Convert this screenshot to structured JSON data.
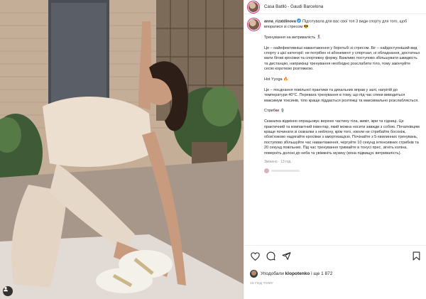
{
  "header": {
    "location": "Casa Batlló - Gaudi Barcelona"
  },
  "caption": {
    "username": "anna_rizatdinova",
    "intro": "Підготувала для вас свої топ 3 види спорту для того, щоб впоратися зі стресом 😎",
    "section1_title": "Тренування на витривалість 🏃‍♀️",
    "section1_body": "Це – найефективніші навантаження у боротьбі зі стресом. Біг – найдоступніший вид спорту з цієї категорії: не потрібен ні абонемент у спортзал, ні обладнання, достатньо мати бігові кросівки та спортивну форму. Важливо поступово збільшувати швидкість та дистанцію, наприкінці тренування необхідно розслабити тіло, тому закінчуйте сесію короткою розтяжкою.",
    "section2_title": "Hot Yyoga 🔥",
    "section2_body": "Це – поєднання повільної практики та дихальних вправ у залі, нагрітій до температури 40°С. Перевага тренування в тому, що під час спеки виводиться максимум токсинів, тіло краще піддається розтяжці та максимально розслабляється.",
    "section3_title": "Стрибки 🪢",
    "section3_body": "Скакалка відмінно опрацьовує верхню частину тіла, живіт, ікри та сідниці. Це практичний та компактний інвентар, який можна носити завжди з собою. Початківцям краще починати зі скакалки з нейлону, крім того, ніколи не стрибайте босоніж, обов'язково надягайте кросівки з амортизацією. Почінайте з 5-хвилинних тренувань, поступово збільшуйте час навантаження, чергуйте 10 секунд інтенсивних стрибків та 20 секунд повільних. Під час тренування тримайте в тонусі прес, зігніть коліна, поверніть долоні до неба та увімкніть музику (вона підвищує витривалість).",
    "meta": "Змінено · 13 год."
  },
  "actions": {
    "like_icon": "heart-icon",
    "comment_icon": "comment-icon",
    "share_icon": "share-icon",
    "save_icon": "bookmark-icon"
  },
  "likes": {
    "prefix": "Уподобали",
    "user": "klopotenko",
    "suffix": "і ще 1 872"
  },
  "date": "15 ГОД ТОМУ",
  "colors": {
    "story_ring": "#d62976",
    "verified": "#3897f0",
    "text": "#262626",
    "muted": "#8e8e8e",
    "divider": "#efefef"
  }
}
